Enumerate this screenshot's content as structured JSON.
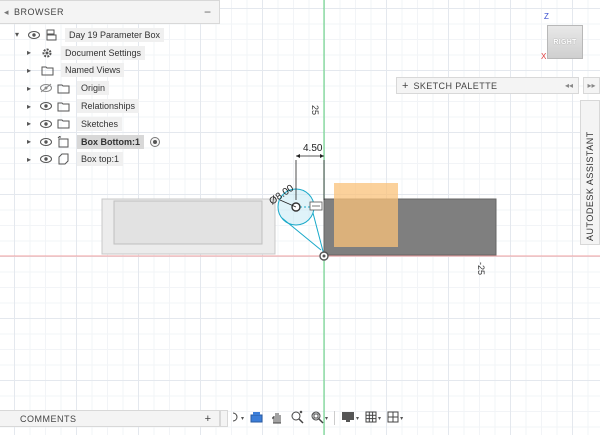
{
  "browser": {
    "title": "BROWSER",
    "items": [
      {
        "label": "Day 19 Parameter Box",
        "icon": "component-icon",
        "arrow": "▾"
      },
      {
        "label": "Document Settings",
        "icon": "gear-icon",
        "arrow": "▸"
      },
      {
        "label": "Named Views",
        "icon": "folder-icon",
        "arrow": "▸"
      },
      {
        "label": "Origin",
        "icon": "folder-icon",
        "arrow": "▸"
      },
      {
        "label": "Relationships",
        "icon": "folder-icon",
        "arrow": "▸"
      },
      {
        "label": "Sketches",
        "icon": "folder-icon",
        "arrow": "▸"
      },
      {
        "label": "Box Bottom:1",
        "icon": "body-icon",
        "arrow": "▸"
      },
      {
        "label": "Box top:1",
        "icon": "body-icon",
        "arrow": "▸"
      }
    ]
  },
  "sketch_palette": {
    "label": "SKETCH PALETTE"
  },
  "assistant": {
    "label": "AUTODESK ASSISTANT"
  },
  "viewcube": {
    "face": "RIGHT",
    "axis_z": "Z",
    "axis_x": "X"
  },
  "dimensions": {
    "vertical_axis_label": "25",
    "horizontal_axis_label": "-25",
    "width_dim": "4.50",
    "diameter_dim": "Ø8.00"
  },
  "comments": {
    "label": "COMMENTS"
  },
  "colors": {
    "accent": "#19a9c9",
    "red_axis": "#f08a8a",
    "green_axis": "#5ad07a",
    "orange": "#f9c27a",
    "body_grey": "#7f7f7f"
  }
}
